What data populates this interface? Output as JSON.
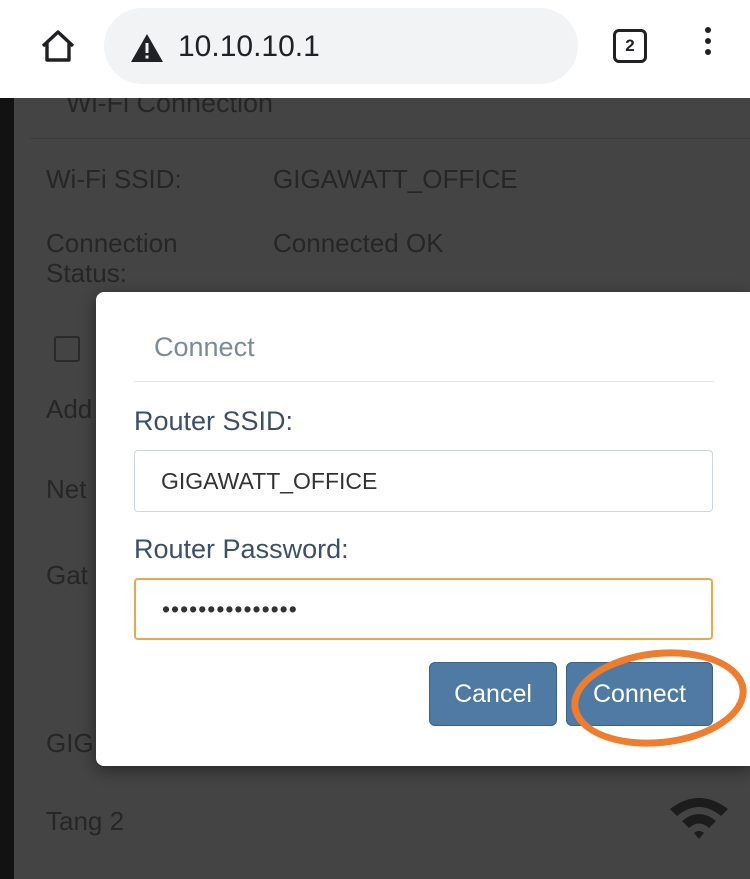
{
  "browser": {
    "url": "10.10.10.1",
    "tab_count": "2",
    "icons": {
      "home": "home-icon",
      "warning": "warning-icon",
      "menu": "kebab-menu-icon"
    }
  },
  "page": {
    "section_title": "Wi-Fi Connection",
    "rows": [
      {
        "label": "Wi-Fi SSID:",
        "value": "GIGAWATT_OFFICE"
      },
      {
        "label": "Connection Status:",
        "value": "Connected OK"
      }
    ],
    "partial_labels": [
      "Add",
      "Net",
      "Gat"
    ],
    "networks": [
      {
        "name": "GIG"
      },
      {
        "name": "Tang 2"
      }
    ]
  },
  "dialog": {
    "title": "Connect",
    "ssid_label": "Router SSID:",
    "ssid_value": "GIGAWATT_OFFICE",
    "password_label": "Router Password:",
    "password_value": "•••••••••••••••",
    "cancel_label": "Cancel",
    "connect_label": "Connect"
  },
  "colors": {
    "primary_button": "#4e7aa3",
    "highlight_ring": "#ee7d30",
    "focus_border": "#e7a94c"
  }
}
